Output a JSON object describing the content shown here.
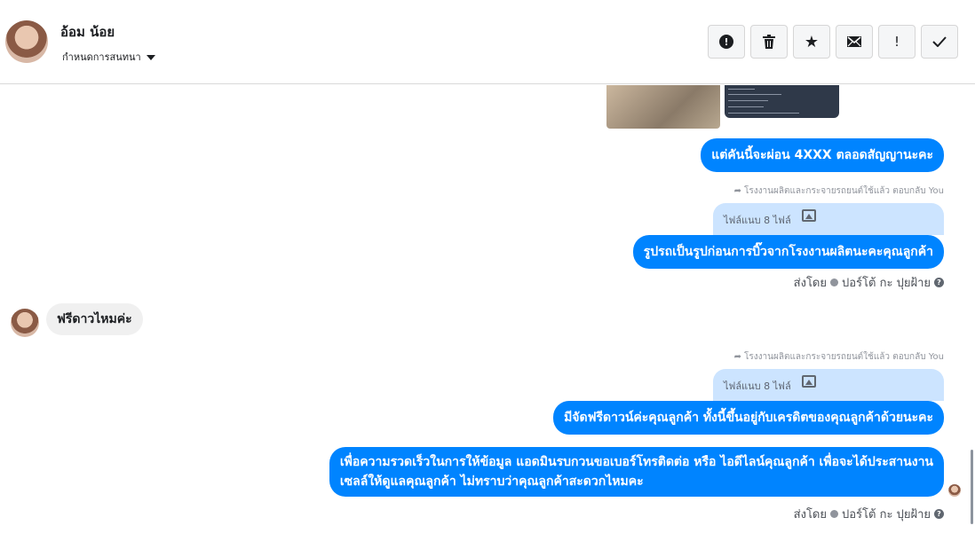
{
  "header": {
    "contact_name": "อ้อม น้อย",
    "assign_label": "กำหนดการสนทนา",
    "toolbar": [
      {
        "name": "spam-button",
        "icon": "!",
        "glyph": "❗"
      },
      {
        "name": "delete-button",
        "icon": "trash-icon",
        "glyph": "🗑"
      },
      {
        "name": "star-button",
        "icon": "star-icon",
        "glyph": "★"
      },
      {
        "name": "mark-unread-button",
        "icon": "envelope-icon",
        "glyph": "✉"
      },
      {
        "name": "important-button",
        "icon": "exclamation-icon",
        "glyph": "!"
      },
      {
        "name": "done-button",
        "icon": "check-icon",
        "glyph": "✓"
      }
    ]
  },
  "messages": {
    "m1": "แต่คันนี้จะผ่อน 4XXX ตลอดสัญญานะคะ",
    "reply_meta_1": "โรงงานผลิตและกระจายรถยนต์ใช้แล้ว ตอบกลับ You",
    "quoted_1": "ไฟล์แนบ 8 ไฟล์",
    "m2": "รูปรถเป็นรูปก่อนการบิ๊วจากโรงงานผลิตนะคะคุณลูกค้า",
    "sent_by_1_prefix": "ส่งโดย",
    "sent_by_1_name": "ปอร์โต้ กะ ปุยฝ้าย",
    "incoming_1": "ฟรีดาวไหมค่ะ",
    "reply_meta_2": "โรงงานผลิตและกระจายรถยนต์ใช้แล้ว ตอบกลับ You",
    "quoted_2": "ไฟล์แนบ 8 ไฟล์",
    "m3": "มีจัดฟรีดาวน์ค่ะคุณลูกค้า ทั้งนี้ขึ้นอยู่กับเครดิตของคุณลูกค้าด้วยนะคะ",
    "m4_line1": "เพื่อความรวดเร็วในการให้ข้อมูล  แอดมินรบกวนขอเบอร์โทรติดต่อ หรือ ไอดีไลน์คุณลูกค้า เพื่อจะได้ประสานงาน",
    "m4_line2": "เซลล์ให้ดูแลคุณลูกค้า ไม่ทราบว่าคุณลูกค้าสะดวกไหมคะ",
    "sent_by_2_prefix": "ส่งโดย",
    "sent_by_2_name": "ปอร์โต้ กะ ปุยฝ้าย"
  },
  "colors": {
    "outgoing_bubble": "#0084ff",
    "incoming_bubble": "#f0f0f0",
    "quoted_bg": "#cce4ff"
  }
}
